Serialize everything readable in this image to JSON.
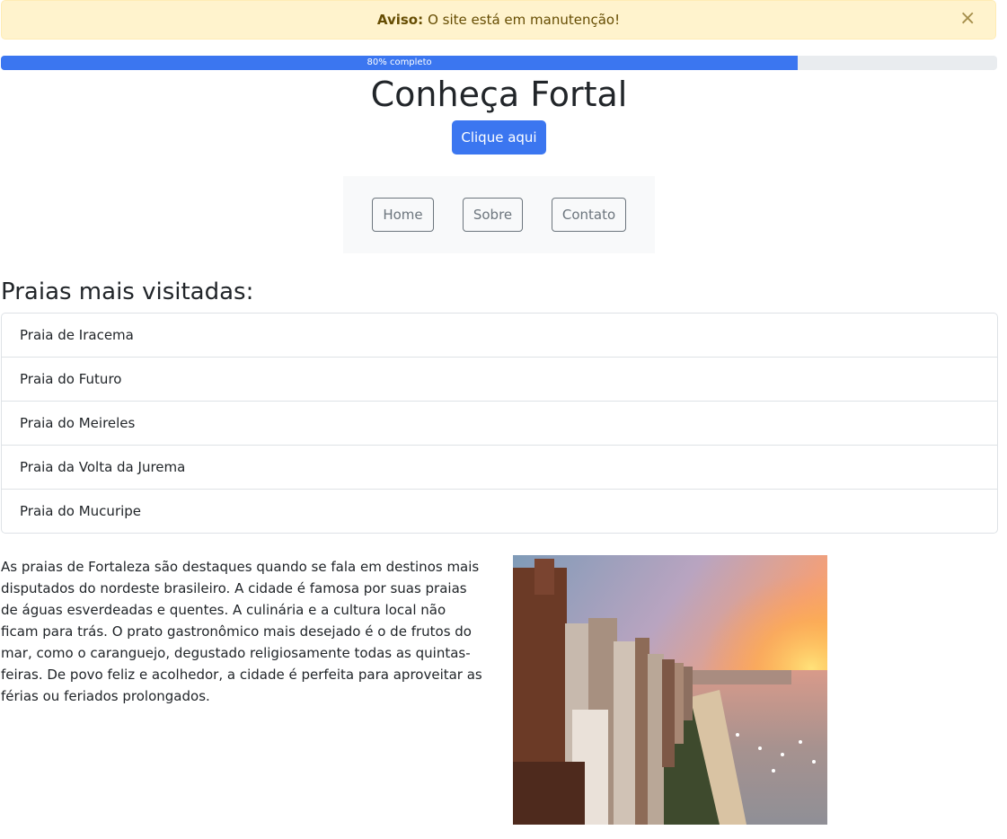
{
  "alert": {
    "label": "Aviso:",
    "message": "O site está em manutenção!",
    "close_symbol": "×"
  },
  "progress": {
    "value": 0.8,
    "label": "80% completo"
  },
  "header": {
    "title": "Conheça Fortal",
    "cta_label": "Clique aqui"
  },
  "nav": {
    "items": [
      {
        "label": "Home"
      },
      {
        "label": "Sobre"
      },
      {
        "label": "Contato"
      }
    ]
  },
  "beaches": {
    "title": "Praias mais visitadas:",
    "items": [
      "Praia de Iracema",
      "Praia do Futuro",
      "Praia do Meireles",
      "Praia da Volta da Jurema",
      "Praia do Mucuripe"
    ]
  },
  "content": {
    "paragraph": "As praias de Fortaleza são destaques quando se fala em destinos mais disputados do nordeste brasileiro. A cidade é famosa por suas praias de águas esverdeadas e quentes. A culinária e a cultura local não ficam para trás. O prato gastronômico mais desejado é o de frutos do mar, como o caranguejo, degustado religiosamente todas as quintas-feiras. De povo feliz e acolhedor, a cidade é perfeita para aproveitar as férias ou feriados prolongados."
  },
  "colors": {
    "primary": "#3b76f0",
    "alert_bg": "#fff3cd",
    "alert_text": "#664d03",
    "secondary": "#6c757d"
  }
}
